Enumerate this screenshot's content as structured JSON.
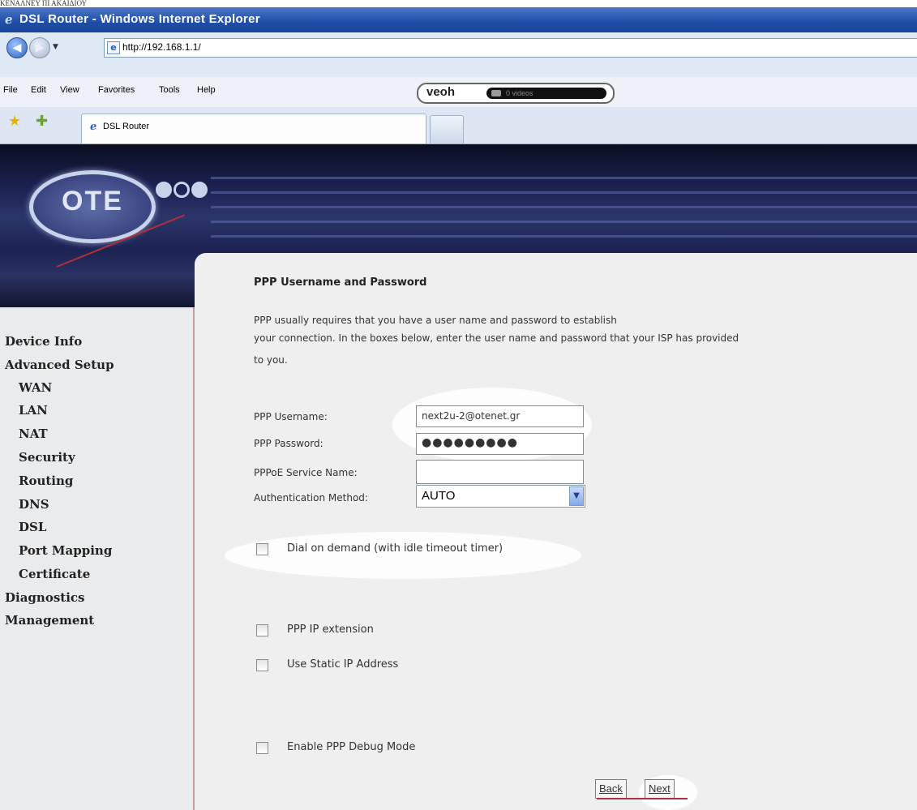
{
  "caption": "ΚΕΝΑΛΝΕΥ ΠΙ ΑΚΑΙΔΙΟΥ",
  "window": {
    "title": "DSL Router - Windows Internet Explorer"
  },
  "address": {
    "url": "http://192.168.1.1/"
  },
  "menu": {
    "items": [
      "File",
      "Edit",
      "View",
      "Favorites",
      "Tools",
      "Help"
    ]
  },
  "toolbar_addon": {
    "logo": "veoh",
    "videos": "0 videos"
  },
  "tabs": [
    {
      "label": "DSL Router"
    }
  ],
  "banner": {
    "logo_text": "OTE"
  },
  "sidebar": {
    "items": [
      {
        "label": "Device Info",
        "level": 0
      },
      {
        "label": "Advanced Setup",
        "level": 0
      },
      {
        "label": "WAN",
        "level": 1
      },
      {
        "label": "LAN",
        "level": 1
      },
      {
        "label": "NAT",
        "level": 1
      },
      {
        "label": "Security",
        "level": 1
      },
      {
        "label": "Routing",
        "level": 1
      },
      {
        "label": "DNS",
        "level": 1
      },
      {
        "label": "DSL",
        "level": 1
      },
      {
        "label": "Port Mapping",
        "level": 1
      },
      {
        "label": "Certificate",
        "level": 1
      },
      {
        "label": "Diagnostics",
        "level": 0
      },
      {
        "label": "Management",
        "level": 0
      }
    ]
  },
  "main": {
    "heading": "PPP Username and Password",
    "paragraph": [
      "PPP usually requires that you have a user name and password to establish",
      "your connection. In the boxes below, enter the user name and password that your ISP has provided",
      "to you."
    ],
    "fields": {
      "username_label": "PPP Username:",
      "username_value": "next2u-2@otenet.gr",
      "password_label": "PPP Password:",
      "password_value": "●●●●●●●●●",
      "service_label": "PPPoE Service Name:",
      "service_value": "",
      "auth_label": "Authentication Method:",
      "auth_value": "AUTO"
    },
    "checkboxes": {
      "dial_on_demand": "Dial on demand (with idle timeout timer)",
      "ppp_ip_extension": "PPP IP extension",
      "static_ip": "Use Static IP Address",
      "debug_mode": "Enable PPP Debug Mode"
    },
    "buttons": {
      "back": "Back",
      "next": "Next"
    }
  }
}
